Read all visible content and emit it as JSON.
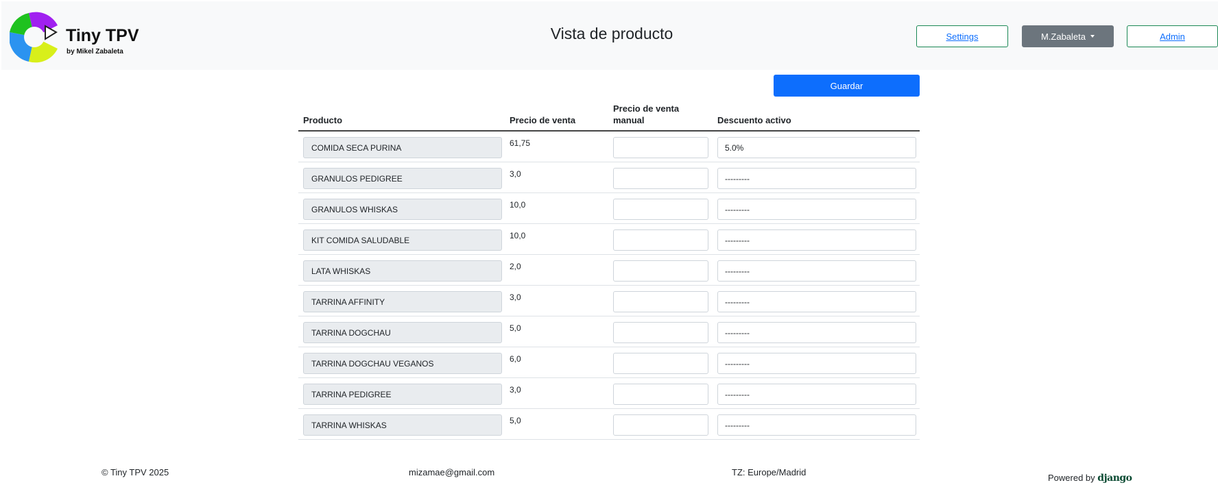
{
  "header": {
    "brand": "Tiny TPV",
    "byline": "by Mikel Zabaleta",
    "page_title": "Vista de producto",
    "settings_label": "Settings",
    "user_label": "M.Zabaleta",
    "admin_label": "Admin",
    "colors": {
      "logo_purple": "#a020f0",
      "logo_green": "#1fc21f",
      "logo_blue": "#2b93f0",
      "logo_yellow": "#d8ef1a",
      "outline_border": "#198754",
      "link": "#0d6efd",
      "user_button": "#6c757d"
    }
  },
  "actions": {
    "save_label": "Guardar",
    "save_color": "#0d6efd"
  },
  "table": {
    "headers": {
      "product": "Producto",
      "price": "Precio de venta",
      "manual_price_line1": "Precio de venta",
      "manual_price_line2": "manual",
      "discount": "Descuento activo"
    },
    "rows": [
      {
        "product": "COMIDA SECA PURINA",
        "price": "61,75",
        "manual": "",
        "discount": "5.0%"
      },
      {
        "product": "GRANULOS PEDIGREE",
        "price": "3,0",
        "manual": "",
        "discount": "---------"
      },
      {
        "product": "GRANULOS WHISKAS",
        "price": "10,0",
        "manual": "",
        "discount": "---------"
      },
      {
        "product": "KIT COMIDA SALUDABLE",
        "price": "10,0",
        "manual": "",
        "discount": "---------"
      },
      {
        "product": "LATA WHISKAS",
        "price": "2,0",
        "manual": "",
        "discount": "---------"
      },
      {
        "product": "TARRINA AFFINITY",
        "price": "3,0",
        "manual": "",
        "discount": "---------"
      },
      {
        "product": "TARRINA DOGCHAU",
        "price": "5,0",
        "manual": "",
        "discount": "---------"
      },
      {
        "product": "TARRINA DOGCHAU VEGANOS",
        "price": "6,0",
        "manual": "",
        "discount": "---------"
      },
      {
        "product": "TARRINA PEDIGREE",
        "price": "3,0",
        "manual": "",
        "discount": "---------"
      },
      {
        "product": "TARRINA WHISKAS",
        "price": "5,0",
        "manual": "",
        "discount": "---------"
      }
    ]
  },
  "footer": {
    "copyright": "© Tiny TPV 2025",
    "email": "mizamae@gmail.com",
    "timezone": "TZ: Europe/Madrid",
    "powered_by": "Powered by",
    "django": "django"
  }
}
